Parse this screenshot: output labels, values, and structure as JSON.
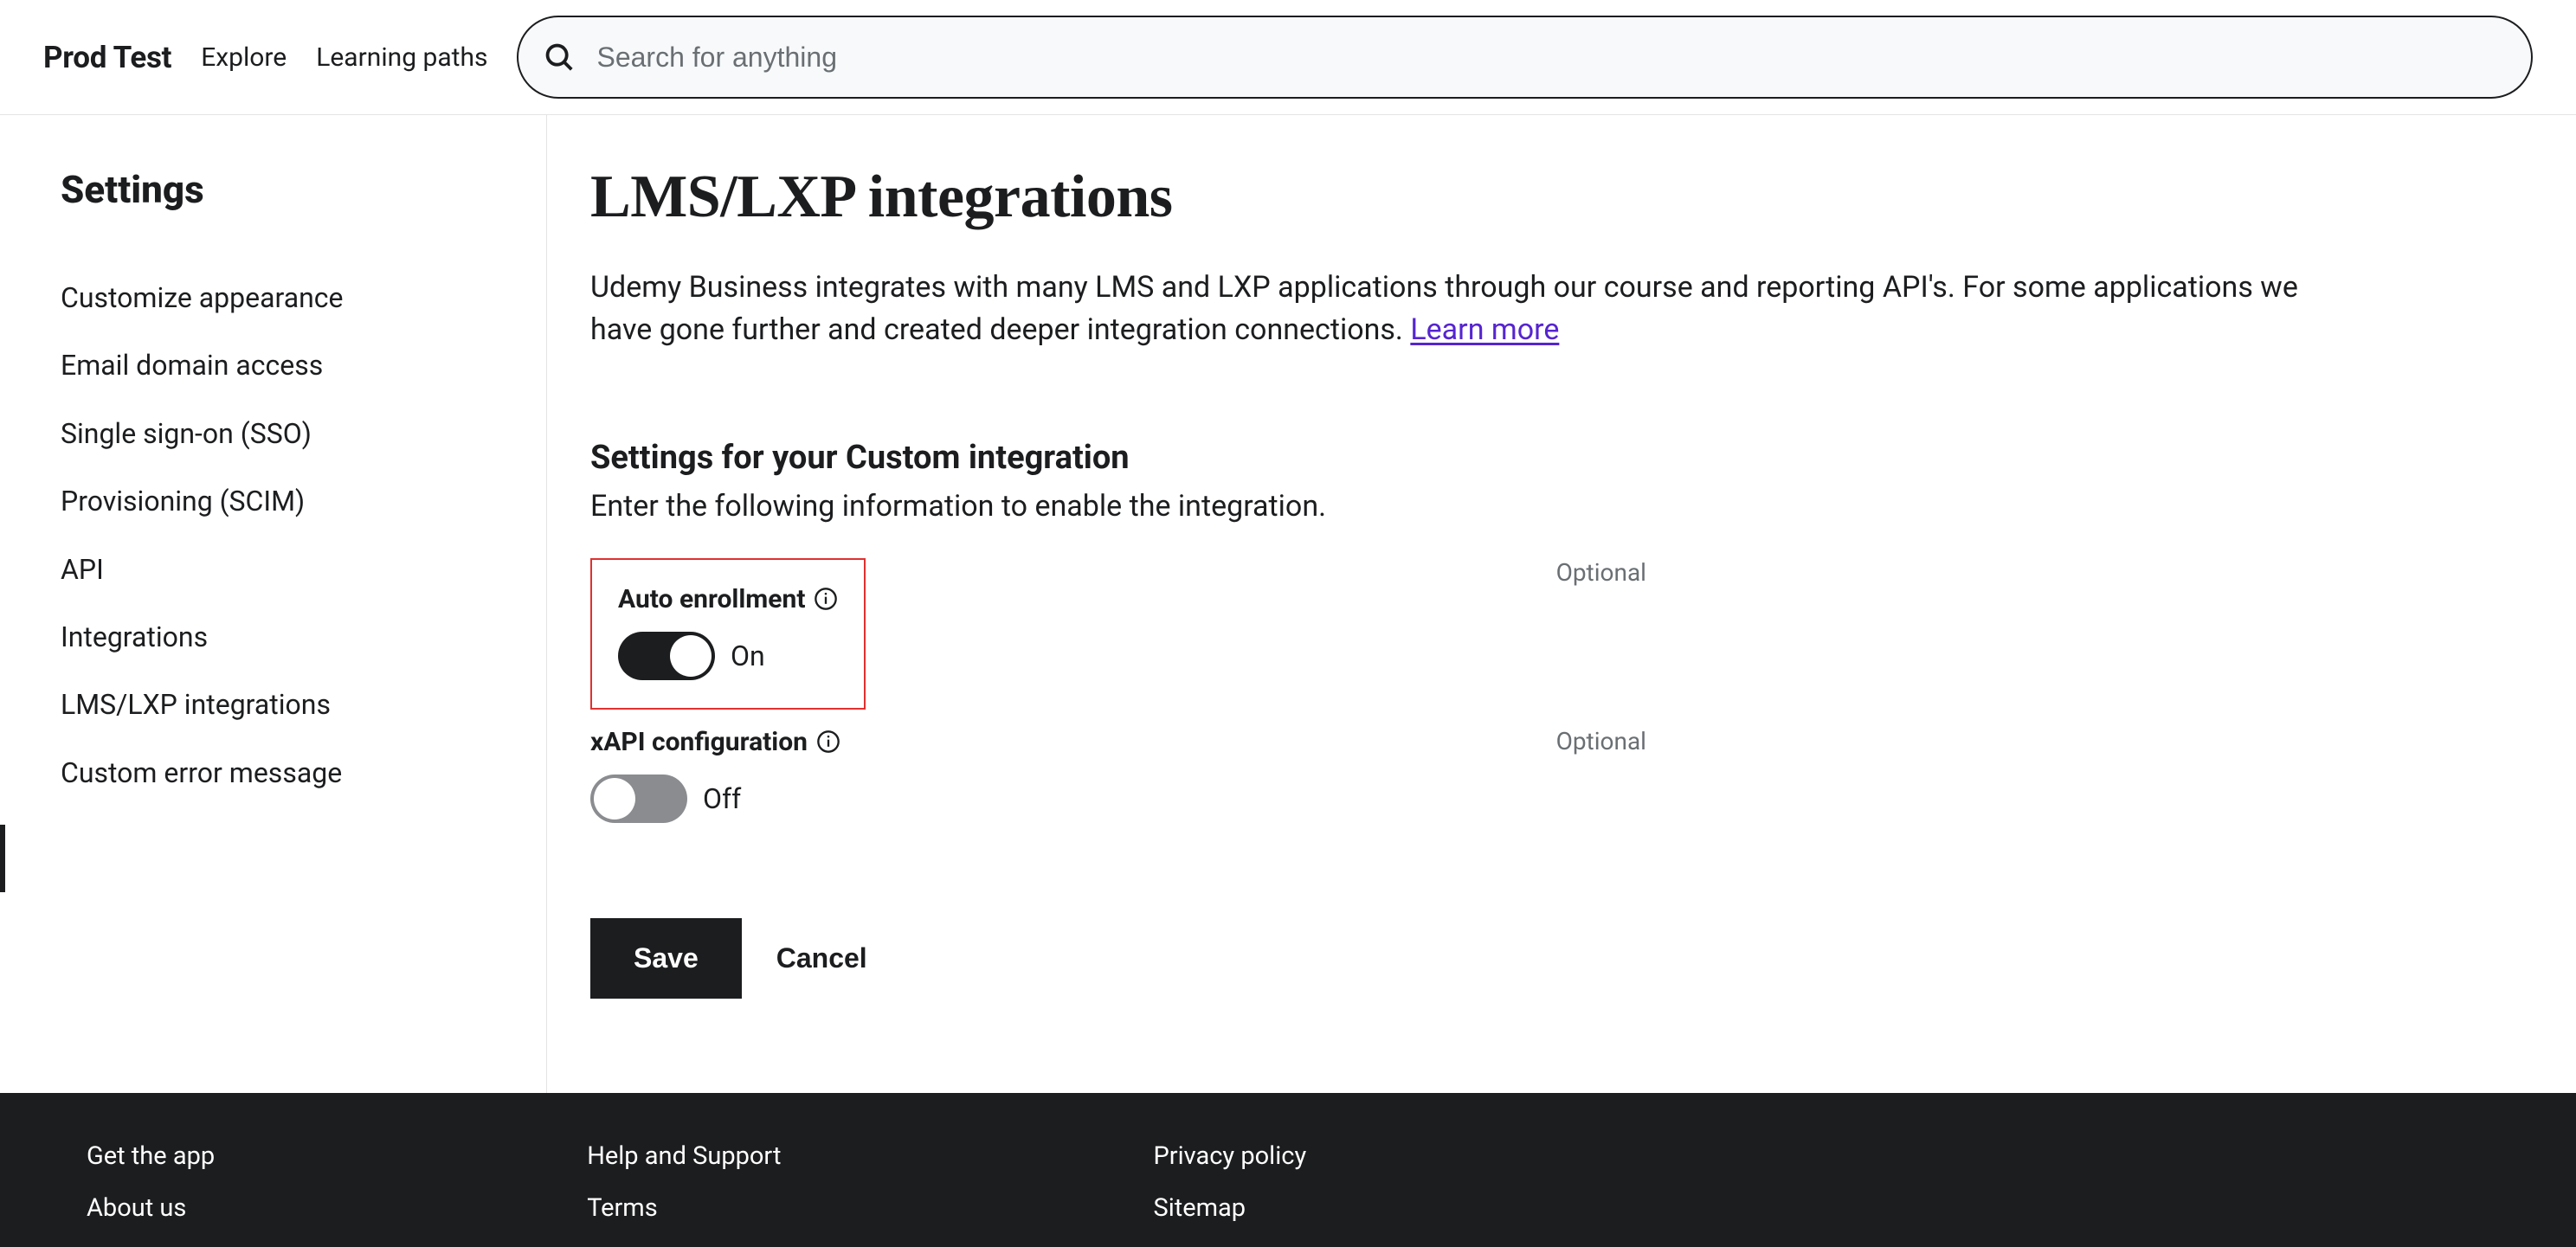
{
  "header": {
    "brand": "Prod Test",
    "nav": [
      "Explore",
      "Learning paths"
    ],
    "search_placeholder": "Search for anything"
  },
  "sidebar": {
    "title": "Settings",
    "items": [
      "Customize appearance",
      "Email domain access",
      "Single sign-on (SSO)",
      "Provisioning (SCIM)",
      "API",
      "Integrations",
      "LMS/LXP integrations",
      "Custom error message"
    ],
    "active_index": 6
  },
  "main": {
    "title": "LMS/LXP integrations",
    "intro_text": "Udemy Business integrates with many LMS and LXP applications through our course and reporting API's. For some applications we have gone further and created deeper integration connections. ",
    "intro_link": "Learn more",
    "section_heading": "Settings for your Custom integration",
    "section_sub": "Enter the following information to enable the integration.",
    "fields": {
      "auto_enroll": {
        "label": "Auto enrollment",
        "optional": "Optional",
        "value_label": "On"
      },
      "xapi": {
        "label": "xAPI configuration",
        "optional": "Optional",
        "value_label": "Off"
      }
    },
    "actions": {
      "save": "Save",
      "cancel": "Cancel"
    }
  },
  "footer": {
    "col1": [
      "Get the app",
      "About us"
    ],
    "col2": [
      "Help and Support",
      "Terms"
    ],
    "col3": [
      "Privacy policy",
      "Sitemap"
    ]
  }
}
